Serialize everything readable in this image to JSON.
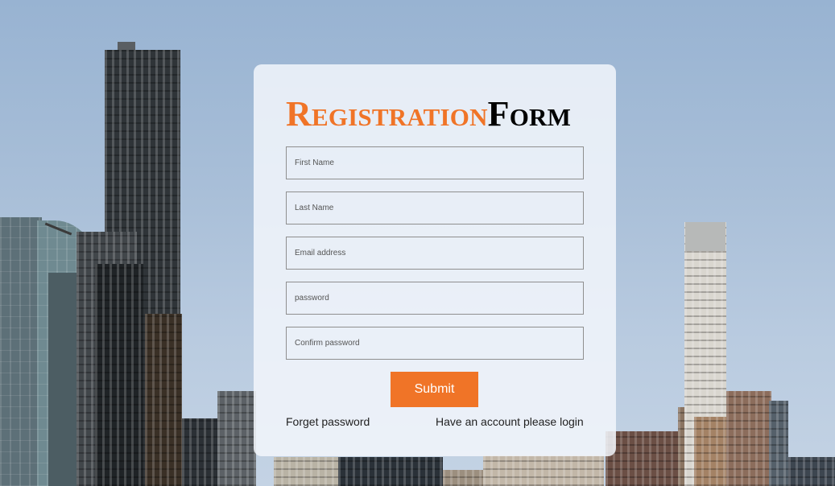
{
  "form": {
    "title_part1": "Registration",
    "title_part2": "Form",
    "fields": [
      {
        "placeholder": "First Name",
        "value": ""
      },
      {
        "placeholder": "Last Name",
        "value": ""
      },
      {
        "placeholder": "Email address",
        "value": ""
      },
      {
        "placeholder": "password",
        "value": ""
      },
      {
        "placeholder": "Confirm password",
        "value": ""
      }
    ],
    "submit_label": "Submit",
    "forget_password_label": "Forget password",
    "login_link_label": "Have an account please login"
  },
  "colors": {
    "accent": "#f07427",
    "sky": "#98b3d2",
    "card": "#f2f6fb"
  }
}
